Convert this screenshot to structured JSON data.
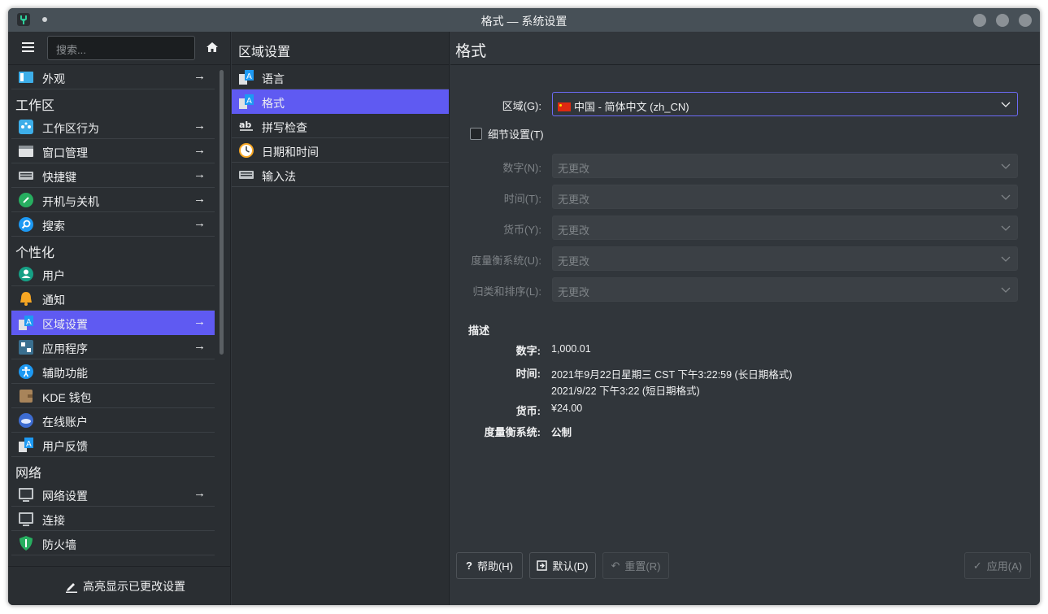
{
  "window": {
    "title": "格式 — 系统设置"
  },
  "sidebar": {
    "search_placeholder": "搜索...",
    "entries": [
      {
        "type": "item",
        "label": "外观",
        "icon": "appearance-icon",
        "arrow": true
      },
      {
        "type": "category",
        "label": "工作区"
      },
      {
        "type": "item",
        "label": "工作区行为",
        "icon": "workspace-behavior-icon",
        "arrow": true
      },
      {
        "type": "item",
        "label": "窗口管理",
        "icon": "window-management-icon",
        "arrow": true
      },
      {
        "type": "item",
        "label": "快捷键",
        "icon": "keyboard-icon",
        "arrow": true
      },
      {
        "type": "item",
        "label": "开机与关机",
        "icon": "startup-shutdown-icon",
        "arrow": true
      },
      {
        "type": "item",
        "label": "搜索",
        "icon": "search-icon",
        "arrow": true
      },
      {
        "type": "category",
        "label": "个性化"
      },
      {
        "type": "item",
        "label": "用户",
        "icon": "user-icon",
        "arrow": false
      },
      {
        "type": "item",
        "label": "通知",
        "icon": "bell-icon",
        "arrow": false
      },
      {
        "type": "item",
        "label": "区域设置",
        "icon": "regional-settings-icon",
        "arrow": true,
        "selected": true
      },
      {
        "type": "item",
        "label": "应用程序",
        "icon": "applications-icon",
        "arrow": true
      },
      {
        "type": "item",
        "label": "辅助功能",
        "icon": "accessibility-icon",
        "arrow": false
      },
      {
        "type": "item",
        "label": "KDE 钱包",
        "icon": "wallet-icon",
        "arrow": false
      },
      {
        "type": "item",
        "label": "在线账户",
        "icon": "online-accounts-icon",
        "arrow": false
      },
      {
        "type": "item",
        "label": "用户反馈",
        "icon": "feedback-icon",
        "arrow": false
      },
      {
        "type": "category",
        "label": "网络"
      },
      {
        "type": "item",
        "label": "网络设置",
        "icon": "network-settings-icon",
        "arrow": true
      },
      {
        "type": "item",
        "label": "连接",
        "icon": "connections-icon",
        "arrow": false
      },
      {
        "type": "item",
        "label": "防火墙",
        "icon": "firewall-icon",
        "arrow": false
      }
    ],
    "highlight_label": "高亮显示已更改设置"
  },
  "middle": {
    "header": "区域设置",
    "items": [
      {
        "label": "语言",
        "icon": "language-icon"
      },
      {
        "label": "格式",
        "icon": "formats-icon",
        "selected": true
      },
      {
        "label": "拼写检查",
        "icon": "spellcheck-icon"
      },
      {
        "label": "日期和时间",
        "icon": "clock-icon"
      },
      {
        "label": "输入法",
        "icon": "input-method-icon"
      }
    ]
  },
  "main": {
    "header": "格式",
    "region_label": "区域(G):",
    "region_value": "中国 - 简体中文 (zh_CN)",
    "detail_checkbox_label": "细节设置(T)",
    "detail_checked": false,
    "detail_fields": [
      {
        "label": "数字(N):",
        "value": "无更改"
      },
      {
        "label": "时间(T):",
        "value": "无更改"
      },
      {
        "label": "货币(Y):",
        "value": "无更改"
      },
      {
        "label": "度量衡系统(U):",
        "value": "无更改"
      },
      {
        "label": "归类和排序(L):",
        "value": "无更改"
      }
    ],
    "description_header": "描述",
    "description": {
      "number_label": "数字:",
      "number_value": "1,000.01",
      "time_label": "时间:",
      "time_long": "2021年9月22日星期三 CST 下午3:22:59 (长日期格式)",
      "time_short": "2021/9/22 下午3:22 (短日期格式)",
      "currency_label": "货币:",
      "currency_value": "¥24.00",
      "measure_label": "度量衡系统:",
      "measure_value": "公制"
    },
    "buttons": {
      "help": "帮助(H)",
      "defaults": "默认(D)",
      "reset": "重置(R)",
      "apply": "应用(A)"
    }
  },
  "colors": {
    "accent": "#5f5af2",
    "window_bg": "#31363b",
    "panel_bg": "#2a2e32",
    "titlebar_bg": "#475057"
  }
}
